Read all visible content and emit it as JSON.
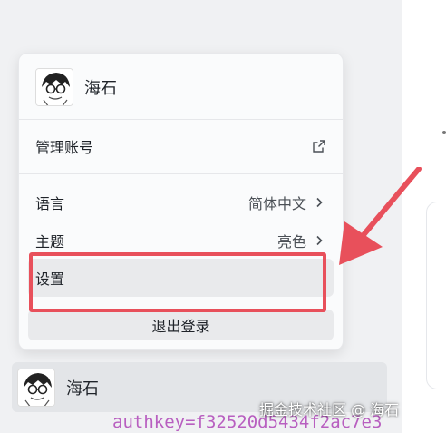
{
  "user": {
    "name": "海石"
  },
  "menu": {
    "manage_account": "管理账号",
    "language_label": "语言",
    "language_value": "简体中文",
    "theme_label": "主题",
    "theme_value": "亮色",
    "settings": "设置",
    "logout": "退出登录"
  },
  "background": {
    "code_snippet": "authkey=f32520d5434f2ac7e3",
    "watermark": "掘金技术社区 @ 海石"
  },
  "colors": {
    "highlight": "#e8505b",
    "popup_bg": "#fafbfc",
    "sidebar_bg": "#f0f1f3"
  },
  "icons": [
    "avatar",
    "external-link-icon",
    "chevron-right-icon",
    "annotation-arrow"
  ]
}
